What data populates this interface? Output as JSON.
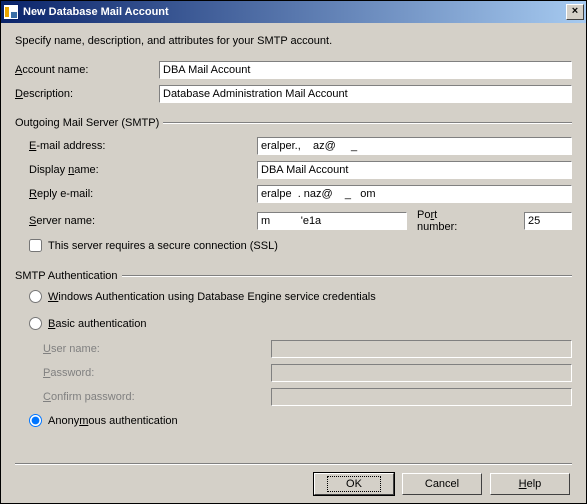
{
  "window": {
    "title": "New Database Mail Account",
    "close_label": "×"
  },
  "instruction": "Specify name, description, and attributes for your SMTP account.",
  "account": {
    "name_label_pre": "A",
    "name_label_rest": "ccount name:",
    "name_value": "DBA Mail Account",
    "desc_label_pre": "D",
    "desc_label_rest": "escription:",
    "desc_value": "Database Administration Mail Account"
  },
  "smtp_group": "Outgoing Mail Server (SMTP)",
  "smtp": {
    "email_label_pre": "E",
    "email_label_rest": "-mail address:",
    "email_value": "eralper.,    az@     _",
    "display_label_pre": "Display ",
    "display_label_u": "n",
    "display_label_post": "ame:",
    "display_value": "DBA Mail Account",
    "reply_label_pre": "R",
    "reply_label_rest": "eply e-mail:",
    "reply_value": "eralpe  . naz@    _   om",
    "server_label_pre": "S",
    "server_label_rest": "erver name:",
    "server_value": "m          'e1a",
    "port_label_pre": "Po",
    "port_label_u": "r",
    "port_label_post": "t number:",
    "port_value": "25",
    "ssl_label": "This server requires a secure connection (SSL)",
    "ssl_checked": false
  },
  "auth_group": "SMTP Authentication",
  "auth": {
    "windows_label_pre": "W",
    "windows_label_rest": "indows Authentication using Database Engine service credentials",
    "basic_label_pre": "B",
    "basic_label_rest": "asic authentication",
    "user_label_pre": "U",
    "user_label_rest": "ser name:",
    "user_value": "",
    "pass_label_pre": "P",
    "pass_label_rest": "assword:",
    "pass_value": "",
    "confirm_label_pre": "C",
    "confirm_label_rest": "onfirm password:",
    "confirm_value": "",
    "anon_label_pre": "Anony",
    "anon_label_u": "m",
    "anon_label_post": "ous authentication",
    "selected": "anonymous"
  },
  "buttons": {
    "ok": "OK",
    "cancel": "Cancel",
    "help_pre": "H",
    "help_rest": "elp"
  }
}
